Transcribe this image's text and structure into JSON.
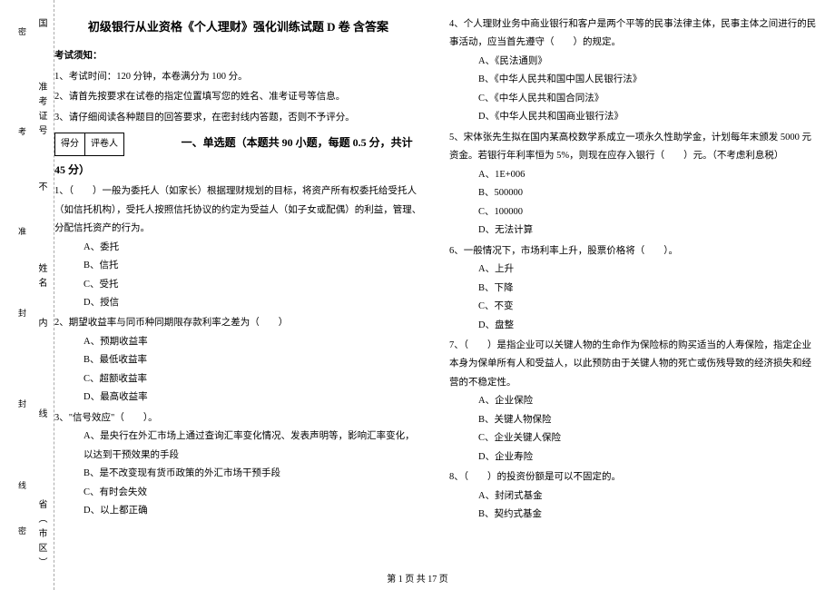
{
  "binding": {
    "labels": [
      "国",
      "准考证号",
      "不",
      "姓名",
      "内",
      "线",
      "省（市区）"
    ],
    "seals": [
      "密",
      "考",
      "准",
      "封",
      "封",
      "线",
      "密"
    ]
  },
  "title": "初级银行从业资格《个人理财》强化训练试题 D 卷 含答案",
  "notice_header": "考试须知：",
  "notices": [
    "1、考试时间：120 分钟，本卷满分为 100 分。",
    "2、请首先按要求在试卷的指定位置填写您的姓名、准考证号等信息。",
    "3、请仔细阅读各种题目的回答要求，在密封线内答题，否则不予评分。"
  ],
  "score_box": {
    "left": "得分",
    "right": "评卷人"
  },
  "section_title": "一、单选题（本题共 90 小题，每题 0.5 分，共计 45 分）",
  "q1": {
    "stem": "1、（　　）一般为委托人（如家长）根据理财规划的目标，将资产所有权委托给受托人（如信托机构），受托人按照信托协议的约定为受益人（如子女或配偶）的利益，管理、分配信托资产的行为。",
    "A": "A、委托",
    "B": "B、信托",
    "C": "C、受托",
    "D": "D、授信"
  },
  "q2": {
    "stem": "2、期望收益率与同币种同期限存款利率之差为（　　）",
    "A": "A、预期收益率",
    "B": "B、最低收益率",
    "C": "C、超额收益率",
    "D": "D、最高收益率"
  },
  "q3": {
    "stem": "3、\"信号效应\"（　　）。",
    "A": "A、是央行在外汇市场上通过查询汇率变化情况、发表声明等，影响汇率变化，以达到干预效果的手段",
    "B": "B、是不改变现有货币政策的外汇市场干预手段",
    "C": "C、有时会失效",
    "D": "D、以上都正确"
  },
  "q4": {
    "stem": "4、个人理财业务中商业银行和客户是两个平等的民事法律主体，民事主体之间进行的民事活动，应当首先遵守（　　）的规定。",
    "A": "A、《民法通则》",
    "B": "B、《中华人民共和国中国人民银行法》",
    "C": "C、《中华人民共和国合同法》",
    "D": "D、《中华人民共和国商业银行法》"
  },
  "q5": {
    "stem": "5、宋体张先生拟在国内某高校数学系成立一项永久性助学金，计划每年末颁发 5000 元资金。若银行年利率恒为 5%，则现在应存入银行（　　）元。（不考虑利息税）",
    "A": "A、1E+006",
    "B": "B、500000",
    "C": "C、100000",
    "D": "D、无法计算"
  },
  "q6": {
    "stem": "6、一般情况下，市场利率上升，股票价格将（　　）。",
    "A": "A、上升",
    "B": "B、下降",
    "C": "C、不变",
    "D": "D、盘整"
  },
  "q7": {
    "stem": "7、（　　）是指企业可以关键人物的生命作为保险标的购买适当的人寿保险，指定企业本身为保单所有人和受益人，以此预防由于关键人物的死亡或伤残导致的经济损失和经营的不稳定性。",
    "A": "A、企业保险",
    "B": "B、关键人物保险",
    "C": "C、企业关键人保险",
    "D": "D、企业寿险"
  },
  "q8": {
    "stem": "8、（　　）的投资份额是可以不固定的。",
    "A": "A、封闭式基金",
    "B": "B、契约式基金"
  },
  "footer": "第 1 页 共 17 页"
}
